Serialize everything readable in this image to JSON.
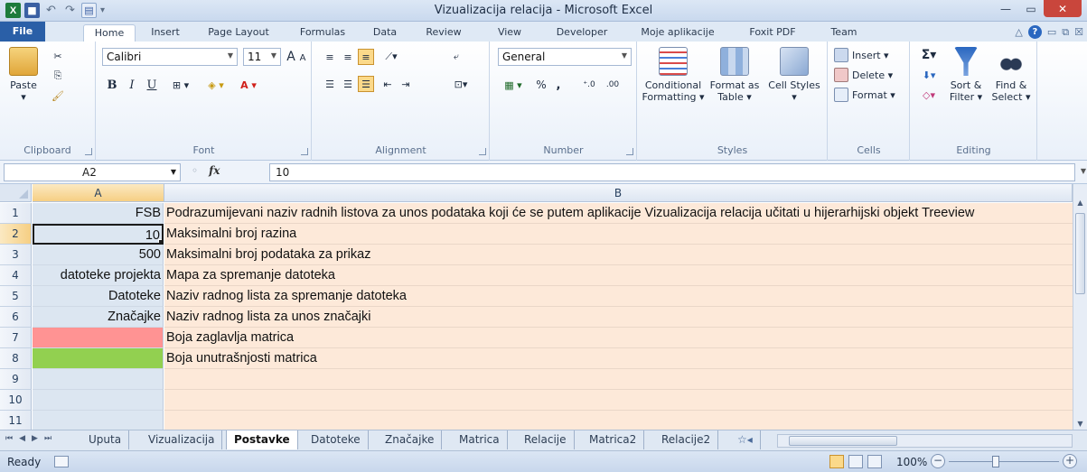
{
  "window": {
    "title": "Vizualizacija relacija - Microsoft Excel",
    "qat_logo": "X"
  },
  "ribbon_tabs": [
    "File",
    "Home",
    "Insert",
    "Page Layout",
    "Formulas",
    "Data",
    "Review",
    "View",
    "Developer",
    "Moje aplikacije",
    "Foxit PDF",
    "Team"
  ],
  "ribbon": {
    "clipboard": {
      "label": "Clipboard",
      "paste": "Paste"
    },
    "font": {
      "label": "Font",
      "name": "Calibri",
      "size": "11",
      "bold": "B",
      "italic": "I",
      "underline": "U"
    },
    "alignment": {
      "label": "Alignment"
    },
    "number": {
      "label": "Number",
      "format": "General",
      "percent": "%",
      "comma": ","
    },
    "styles": {
      "label": "Styles",
      "conditional": "Conditional Formatting ▾",
      "format_table": "Format as Table ▾",
      "cell_styles": "Cell Styles ▾"
    },
    "cells": {
      "label": "Cells",
      "insert": "Insert ▾",
      "delete": "Delete ▾",
      "format": "Format ▾"
    },
    "editing": {
      "label": "Editing",
      "sort": "Sort & Filter ▾",
      "find": "Find & Select ▾"
    }
  },
  "formula_bar": {
    "name_box": "A2",
    "fx": "fx",
    "value": "10"
  },
  "columns": [
    "A",
    "B"
  ],
  "rows": [
    {
      "num": "1",
      "a": "FSB",
      "b": "Podrazumijevani naziv radnih listova za unos podataka koji će se putem aplikacije Vizualizacija relacija učitati u hijerarhijski objekt Treeview"
    },
    {
      "num": "2",
      "a": "10",
      "b": "Maksimalni broj razina"
    },
    {
      "num": "3",
      "a": "500",
      "b": "Maksimalni broj podataka za prikaz"
    },
    {
      "num": "4",
      "a": "datoteke projekta",
      "b": "Mapa za spremanje datoteka"
    },
    {
      "num": "5",
      "a": "Datoteke",
      "b": "Naziv radnog lista za spremanje datoteka"
    },
    {
      "num": "6",
      "a": "Značajke",
      "b": "Naziv radnog lista za unos značajki"
    },
    {
      "num": "7",
      "a": "",
      "b": "Boja zaglavlja matrica",
      "a_color": "#ff9393"
    },
    {
      "num": "8",
      "a": "",
      "b": "Boja unutrašnjosti matrica",
      "a_color": "#92d050"
    },
    {
      "num": "9",
      "a": "",
      "b": ""
    },
    {
      "num": "10",
      "a": "",
      "b": ""
    },
    {
      "num": "11",
      "a": "",
      "b": ""
    }
  ],
  "sheet_tabs": [
    "Uputa",
    "Vizualizacija",
    "Postavke",
    "Datoteke",
    "Značajke",
    "Matrica",
    "Relacije",
    "Matrica2",
    "Relacije2"
  ],
  "active_sheet": "Postavke",
  "status": {
    "ready": "Ready",
    "zoom": "100%"
  }
}
